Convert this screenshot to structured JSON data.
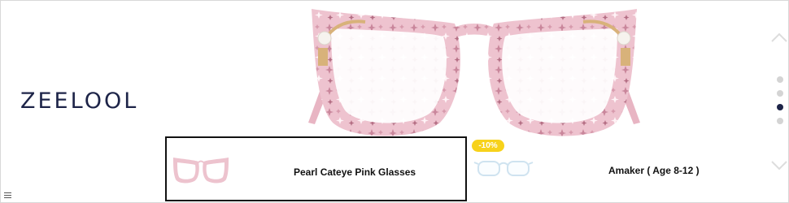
{
  "brand": {
    "name": "ZEELOOL"
  },
  "hero": {
    "image_icon": "pink-cateye-glasses-illustration"
  },
  "products": [
    {
      "name": "Pearl Cateye Pink Glasses",
      "selected": true,
      "thumb_icon": "pink-glasses-thumbnail"
    },
    {
      "name": "Amaker ( Age 8-12 )",
      "selected": false,
      "discount": "-10%",
      "thumb_icon": "clear-glasses-thumbnail"
    }
  ],
  "carousel": {
    "dot_count": 4,
    "active_index": 2
  },
  "colors": {
    "brand_navy": "#1d2448",
    "frame_pink": "#e9b9c7",
    "badge_yellow": "#f7d21b"
  }
}
